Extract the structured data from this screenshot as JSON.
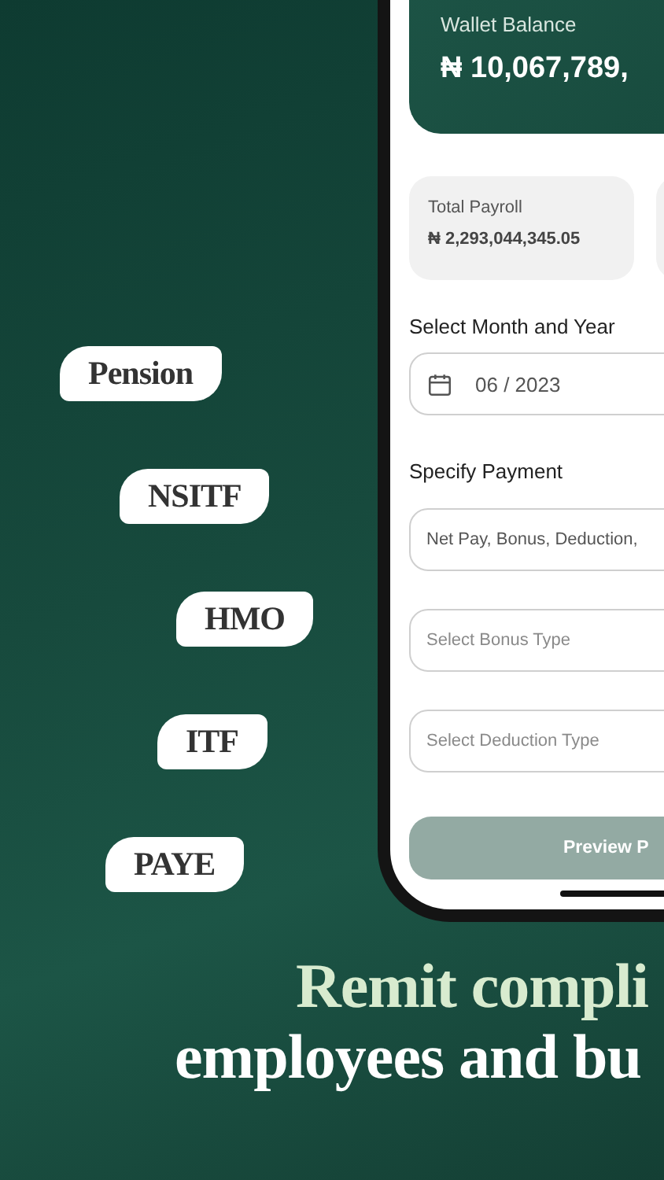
{
  "tags": [
    {
      "label": "Pension"
    },
    {
      "label": "NSITF"
    },
    {
      "label": "HMO"
    },
    {
      "label": "ITF"
    },
    {
      "label": "PAYE"
    }
  ],
  "wallet": {
    "label": "Wallet Balance",
    "amount": "₦ 10,067,789,"
  },
  "summary_cards": [
    {
      "label": "Total Payroll",
      "value": "₦ 2,293,044,345.05"
    }
  ],
  "period": {
    "label": "Select Month and Year",
    "value": "06 / 2023"
  },
  "payment": {
    "label": "Specify Payment",
    "fields": [
      {
        "value": "Net Pay, Bonus, Deduction,"
      },
      {
        "placeholder": "Select Bonus Type"
      },
      {
        "placeholder": "Select Deduction Type"
      }
    ]
  },
  "preview_button": {
    "label": "Preview P",
    "disabled": true
  },
  "headline": [
    {
      "text": "Remit compli",
      "kind": "accent"
    },
    {
      "text": "employees and bu",
      "kind": "plain"
    }
  ]
}
